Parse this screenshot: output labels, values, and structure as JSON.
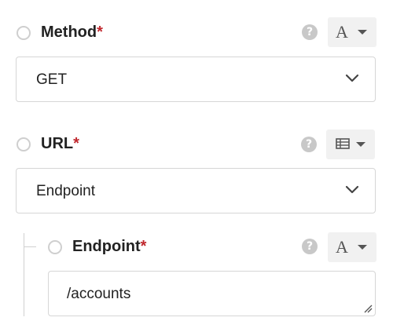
{
  "fields": {
    "method": {
      "label": "Method",
      "required_mark": "*",
      "help": "?",
      "type_glyph": "A",
      "value": "GET"
    },
    "url": {
      "label": "URL",
      "required_mark": "*",
      "help": "?",
      "value": "Endpoint"
    },
    "endpoint": {
      "label": "Endpoint",
      "required_mark": "*",
      "help": "?",
      "type_glyph": "A",
      "value": "/accounts"
    }
  },
  "colors": {
    "required": "#c0272d",
    "border": "#d6d6d6",
    "type_button_bg": "#f1f1f1",
    "help_icon": "#c8c8c8"
  },
  "icons": {
    "method_type": "text-type-icon",
    "url_type": "table-icon",
    "endpoint_type": "text-type-icon",
    "dropdown": "chevron-down-icon",
    "resize": "resize-handle-icon"
  }
}
